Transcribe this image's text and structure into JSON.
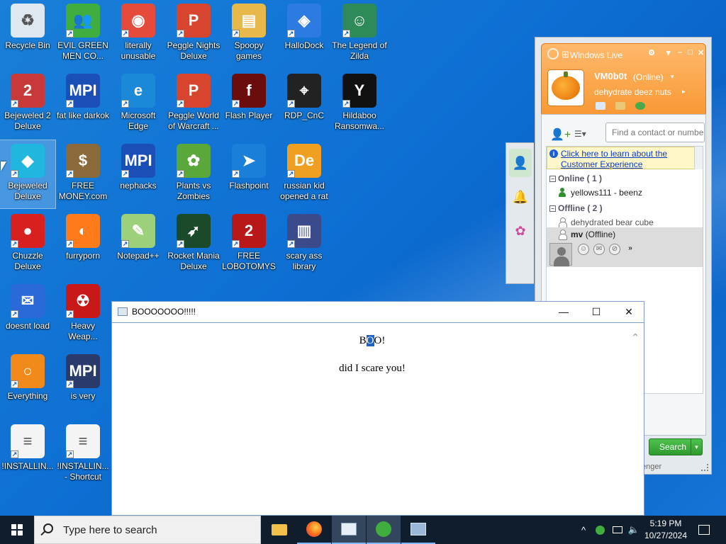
{
  "desktop": {
    "icons": [
      {
        "label": "Recycle Bin",
        "icon": "recycle-bin-icon",
        "color": "#dfe8f0",
        "glyph": "♻"
      },
      {
        "label": "EVIL GREEN MEN CO...",
        "icon": "messenger-icon",
        "color": "#3fae3f",
        "glyph": "👥"
      },
      {
        "label": "literally unusable",
        "icon": "chrome-icon",
        "color": "#e64a3b",
        "glyph": "◉"
      },
      {
        "label": "Peggle Nights Deluxe",
        "icon": "peggle-icon",
        "color": "#d8452f",
        "glyph": "P"
      },
      {
        "label": "Spoopy games",
        "icon": "folder-icon",
        "color": "#e8b84a",
        "glyph": "▤"
      },
      {
        "label": "HalloDock",
        "icon": "shield-icon",
        "color": "#2b7be0",
        "glyph": "◈"
      },
      {
        "label": "The Legend of Zilda",
        "icon": "zelda-icon",
        "color": "#2f8a5a",
        "glyph": "☺"
      },
      {
        "label": "Bejeweled 2 Deluxe",
        "icon": "bejeweled2-icon",
        "color": "#c83a3a",
        "glyph": "2"
      },
      {
        "label": "fat like darkok",
        "icon": "mpi-icon",
        "color": "#1b4fb8",
        "glyph": "MPI"
      },
      {
        "label": "Microsoft Edge",
        "icon": "edge-icon",
        "color": "#1a8ad8",
        "glyph": "e"
      },
      {
        "label": "Peggle World of Warcraft ...",
        "icon": "peggle-icon",
        "color": "#d8452f",
        "glyph": "P"
      },
      {
        "label": "Flash Player",
        "icon": "flash-icon",
        "color": "#6b0d0d",
        "glyph": "f"
      },
      {
        "label": "RDP_CnC",
        "icon": "rdp-icon",
        "color": "#222222",
        "glyph": "⌖"
      },
      {
        "label": "Hildaboo Ransomwa...",
        "icon": "yashma-icon",
        "color": "#111111",
        "glyph": "Y"
      },
      {
        "label": "Bejeweled Deluxe",
        "icon": "gem-icon",
        "color": "#1fb6e0",
        "glyph": "◆"
      },
      {
        "label": "FREE MONEY.com",
        "icon": "money-bag-icon",
        "color": "#8a6a3a",
        "glyph": "$"
      },
      {
        "label": "nephacks",
        "icon": "mpi-icon",
        "color": "#1b4fb8",
        "glyph": "MPI"
      },
      {
        "label": "Plants vs Zombies",
        "icon": "pvz-icon",
        "color": "#5aa83a",
        "glyph": "✿"
      },
      {
        "label": "Flashpoint",
        "icon": "flashpoint-icon",
        "color": "#1a7fd8",
        "glyph": "➤"
      },
      {
        "label": "russian kid opened a rat",
        "icon": "de-icon",
        "color": "#f0a020",
        "glyph": "De"
      },
      {
        "label": "Chuzzle Deluxe",
        "icon": "chuzzle-icon",
        "color": "#d82020",
        "glyph": "●"
      },
      {
        "label": "furryporn",
        "icon": "firefox-icon",
        "color": "#ff7a1a",
        "glyph": "◐"
      },
      {
        "label": "Notepad++",
        "icon": "notepadpp-icon",
        "color": "#9cd07a",
        "glyph": "✎"
      },
      {
        "label": "Rocket Mania Deluxe",
        "icon": "rocket-icon",
        "color": "#1a4a2a",
        "glyph": "➶"
      },
      {
        "label": "FREE LOBOTOMYS",
        "icon": "clock-icon",
        "color": "#b81818",
        "glyph": "2"
      },
      {
        "label": "scary ass library",
        "icon": "library-icon",
        "color": "#3a4a8a",
        "glyph": "▥"
      },
      {
        "label": "doesnt load",
        "icon": "thunderbird-icon",
        "color": "#2a6ad8",
        "glyph": "✉"
      },
      {
        "label": "Heavy Weap...",
        "icon": "radiation-icon",
        "color": "#c81818",
        "glyph": "☢"
      },
      {
        "label": "Everything",
        "icon": "search-icon",
        "color": "#f08a1a",
        "glyph": "○"
      },
      {
        "label": "is very",
        "icon": "mpi-icon",
        "color": "#2a3a6a",
        "glyph": "MPI"
      },
      {
        "label": "!INSTALLIN...",
        "icon": "text-file-icon",
        "color": "#f4f4f4",
        "glyph": "≡"
      },
      {
        "label": "!INSTALLIN... - Shortcut",
        "icon": "text-file-icon",
        "color": "#f4f4f4",
        "glyph": "≡"
      }
    ]
  },
  "messenger": {
    "title": "Windows Live",
    "username": "VM0b0t",
    "status": "(Online)",
    "personal_message": "dehydrate deez nuts",
    "search_placeholder": "Find a contact or number",
    "info_link": "Click here to learn about the Customer Experience",
    "groups": {
      "online_label": "Online ( 1 )",
      "offline_label": "Offline ( 2 )"
    },
    "contacts": {
      "online": [
        "yellows111 - beenz"
      ],
      "offline_1": "dehydrated bear cube",
      "selected_name": "mv",
      "selected_status": "(Offline)"
    },
    "search_button": "Search",
    "footer": "enger",
    "accent": "#f58a1e"
  },
  "dialog": {
    "title": "BOOOOOOO!!!!!",
    "heading_pre": "B",
    "heading_sel": "O",
    "heading_post": "O!",
    "body": "did I scare you!"
  },
  "taskbar": {
    "search_placeholder": "Type here to search",
    "time": "5:19 PM",
    "date": "10/27/2024",
    "apps": [
      "file-explorer-icon",
      "firefox-icon",
      "dialog-app-icon",
      "messenger-icon",
      "remote-desktop-icon"
    ]
  }
}
